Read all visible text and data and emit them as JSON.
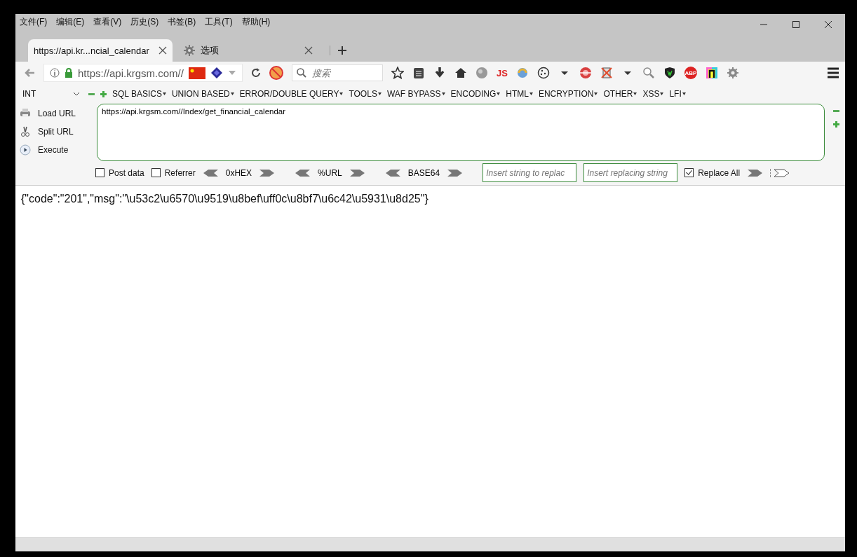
{
  "menu_bar": [
    "文件(F)",
    "编辑(E)",
    "查看(V)",
    "历史(S)",
    "书签(B)",
    "工具(T)",
    "帮助(H)"
  ],
  "tabs": [
    {
      "label": "https://api.kr...ncial_calendar",
      "selected": true,
      "kind": "page"
    },
    {
      "label": "选项",
      "selected": false,
      "kind": "settings"
    }
  ],
  "address_bar": {
    "url": "https://api.krgsm.com//"
  },
  "search": {
    "placeholder": "搜索"
  },
  "toolbar_icons": [
    {
      "kind": "star"
    },
    {
      "kind": "clipboard"
    },
    {
      "kind": "download"
    },
    {
      "kind": "home"
    },
    {
      "kind": "globe"
    },
    {
      "kind": "text",
      "text": "JS"
    },
    {
      "kind": "swirl"
    },
    {
      "kind": "cookie"
    },
    {
      "kind": "caret"
    },
    {
      "kind": "target"
    },
    {
      "kind": "crossed"
    },
    {
      "kind": "caret"
    },
    {
      "kind": "magnifier"
    },
    {
      "kind": "shield"
    },
    {
      "kind": "abp",
      "text": "ABP"
    },
    {
      "kind": "n-tile"
    },
    {
      "kind": "gear"
    }
  ],
  "hackbar": {
    "type_select": "INT",
    "menus": [
      "SQL BASICS",
      "UNION BASED",
      "ERROR/DOUBLE QUERY",
      "TOOLS",
      "WAF BYPASS",
      "ENCODING",
      "HTML",
      "ENCRYPTION",
      "OTHER",
      "XSS",
      "LFI"
    ],
    "actions": [
      {
        "label": "Load URL",
        "kind": "load"
      },
      {
        "label": "Split URL",
        "kind": "split"
      },
      {
        "label": "Execute",
        "kind": "execute"
      }
    ],
    "url_value": "https://api.krgsm.com//Index/get_financial_calendar",
    "post_data": {
      "label": "Post data",
      "checked": false
    },
    "referrer": {
      "label": "Referrer",
      "checked": false
    },
    "encoders": [
      "0xHEX",
      "%URL",
      "BASE64"
    ],
    "replace_from": {
      "placeholder": "Insert string to replac"
    },
    "replace_to": {
      "placeholder": "Insert replacing string"
    },
    "replace_all": {
      "label": "Replace All",
      "checked": true
    }
  },
  "body_text": "{\"code\":\"201\",\"msg\":\"\\u53c2\\u6570\\u9519\\u8bef\\uff0c\\u8bf7\\u6c42\\u5931\\u8d25\"}"
}
